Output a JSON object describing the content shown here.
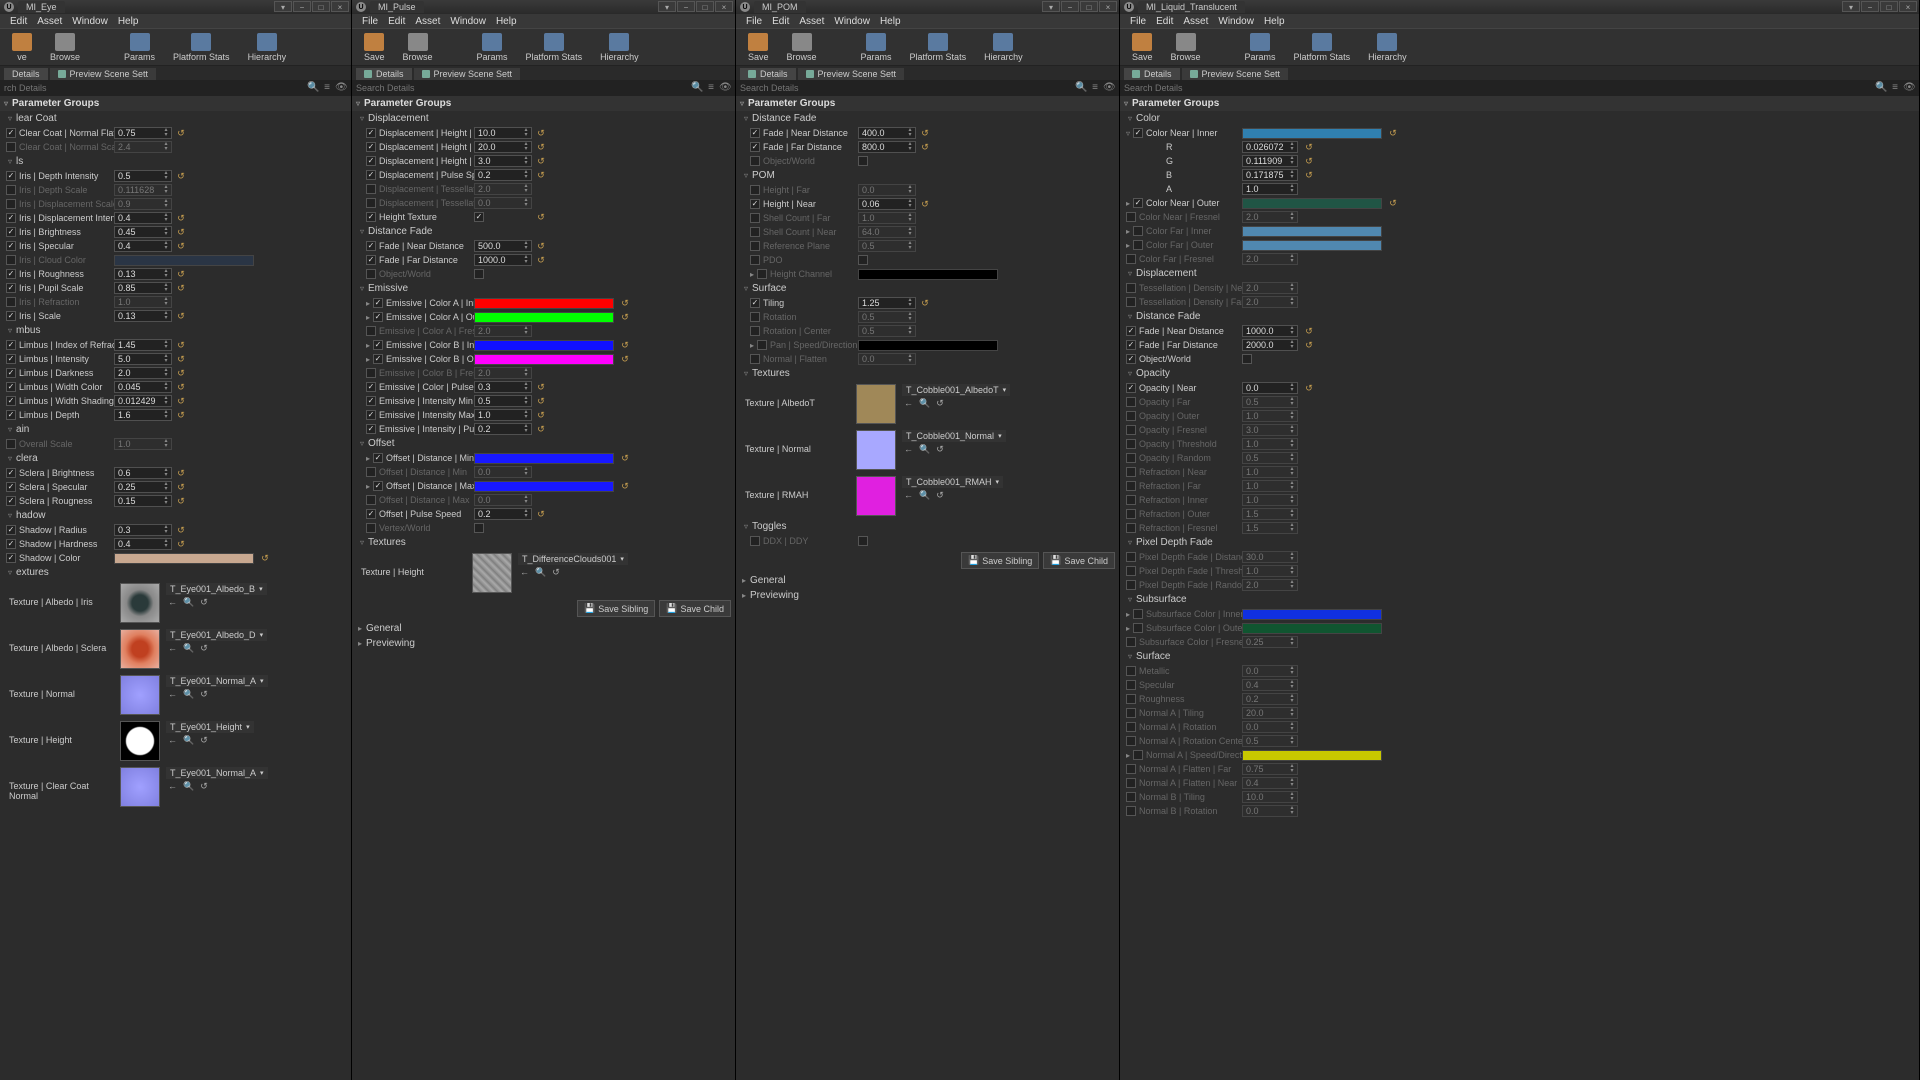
{
  "windows": [
    {
      "title": "MI_Eye"
    },
    {
      "title": "MI_Pulse"
    },
    {
      "title": "MI_POM"
    },
    {
      "title": "MI_Liquid_Translucent"
    }
  ],
  "menu": [
    "File",
    "Edit",
    "Asset",
    "Window",
    "Help"
  ],
  "menu0": [
    "Edit",
    "Asset",
    "Window",
    "Help"
  ],
  "toolbar": {
    "save": "Save",
    "browse": "Browse",
    "params": "Params",
    "platform": "Platform Stats",
    "hierarchy": "Hierarchy"
  },
  "toolbar0": {
    "ve": "ve",
    "browse": "Browse",
    "params": "Params",
    "platform": "Platform Stats",
    "hierarchy": "Hierarchy"
  },
  "tabs": {
    "details": "Details",
    "preview": "Preview Scene Sett"
  },
  "search_ph": "Search Details",
  "search_ph0": "rch Details",
  "hdr": {
    "pg": "Parameter Groups",
    "general": "General",
    "previewing": "Previewing"
  },
  "btn": {
    "saveSib": "Save Sibling",
    "saveChild": "Save Child"
  },
  "eye": {
    "g0": "lear Coat",
    "g1": "ls",
    "g2": "mbus",
    "g3": "ain",
    "g4": "clera",
    "g5": "hadow",
    "g6": "extures",
    "ccnf": "Clear Coat | Normal Flatten",
    "ccnf_v": "0.75",
    "ccns": "Clear Coat | Normal Scale",
    "ccns_v": "2.4",
    "idi": "Iris | Depth Intensity",
    "idi_v": "0.5",
    "ids": "Iris | Depth Scale",
    "ids_v": "0.111628",
    "idis": "Iris | Displacement Scale",
    "idis_v": "0.9",
    "idin": "Iris | Displacement Intensity",
    "idin_v": "0.4",
    "ib": "Iris | Brightness",
    "ib_v": "0.45",
    "isp": "Iris | Specular",
    "isp_v": "0.4",
    "icc": "Iris | Cloud Color",
    "ir": "Iris | Roughness",
    "ir_v": "0.13",
    "ips": "Iris | Pupil Scale",
    "ips_v": "0.85",
    "iref": "Iris | Refraction",
    "iref_v": "1.0",
    "isc": "Iris | Scale",
    "isc_v": "0.13",
    "lir": "Limbus | Index of Refraction",
    "lir_v": "1.45",
    "li": "Limbus | Intensity",
    "li_v": "5.0",
    "ld": "Limbus | Darkness",
    "ld_v": "2.0",
    "lwc": "Limbus | Width Color",
    "lwc_v": "0.045",
    "lws": "Limbus | Width Shading",
    "lws_v": "0.012429",
    "ldp": "Limbus | Depth",
    "ldp_v": "1.6",
    "os": "Overall Scale",
    "os_v": "1.0",
    "sb": "Sclera | Brightness",
    "sb_v": "0.6",
    "ss": "Sclera | Specular",
    "ss_v": "0.25",
    "sr": "Sclera | Rougness",
    "sr_v": "0.15",
    "shr": "Shadow | Radius",
    "shr_v": "0.3",
    "shh": "Shadow | Hardness",
    "shh_v": "0.4",
    "shc": "Shadow | Color",
    "tai": "Texture | Albedo | Iris",
    "tai_n": "T_Eye001_Albedo_B",
    "tas": "Texture | Albedo | Sclera",
    "tas_n": "T_Eye001_Albedo_D",
    "tn": "Texture | Normal",
    "tn_n": "T_Eye001_Normal_A",
    "th": "Texture | Height",
    "th_n": "T_Eye001_Height",
    "tcc": "Texture | Clear Coat Normal",
    "tcc_n": "T_Eye001_Normal_A"
  },
  "pulse": {
    "g0": "Displacement",
    "g1": "Distance Fade",
    "g2": "Emissive",
    "g3": "Offset",
    "g4": "Textures",
    "dhmin": "Displacement | Height | Min",
    "dhmin_v": "10.0",
    "dhmax": "Displacement | Height | Max",
    "dhmax_v": "20.0",
    "dht": "Displacement | Height | Tiling",
    "dht_v": "3.0",
    "dps": "Displacement | Pulse Speed",
    "dps_v": "0.2",
    "dtd": "Displacement | Tessellation Dens",
    "dtd_v": "2.0",
    "dtd2": "Displacement | Tessellation Dens",
    "dtd2_v": "0.0",
    "ht": "Height Texture",
    "fnd": "Fade | Near Distance",
    "fnd_v": "500.0",
    "ffd": "Fade | Far Distance",
    "ffd_v": "1000.0",
    "ow": "Object/World",
    "ecai": "Emissive | Color A | Inner",
    "ecao": "Emissive | Color A | Outer",
    "ecaf": "Emissive | Color A | Fresnel",
    "ecaf_v": "2.0",
    "ecbi": "Emissive | Color B | Inner",
    "ecbo": "Emissive | Color B | Outer",
    "ecbf": "Emissive | Color B | Fresnel",
    "ecbf_v": "2.0",
    "ecps": "Emissive | Color | Pulse Speed",
    "ecps_v": "0.3",
    "eimin": "Emissive | Intensity Min",
    "eimin_v": "0.5",
    "eimax": "Emissive | Intensity Max",
    "eimax_v": "1.0",
    "eips": "Emissive | Intensity | Pulse Speed",
    "eips_v": "0.2",
    "odmin": "Offset | Distance | Min",
    "odmin2": "Offset | Distance | Min",
    "odmin2_v": "0.0",
    "odmax": "Offset | Distance | Max",
    "odmax2": "Offset | Distance | Max",
    "odmax2_v": "0.0",
    "ops": "Offset | Pulse Speed",
    "ops_v": "0.2",
    "vw": "Vertex/World",
    "th": "Texture | Height",
    "th_n": "T_DifferenceClouds001"
  },
  "pom": {
    "g0": "Distance Fade",
    "g1": "POM",
    "g2": "Surface",
    "g3": "Textures",
    "g4": "Toggles",
    "fnd": "Fade | Near Distance",
    "fnd_v": "400.0",
    "ffd": "Fade | Far Distance",
    "ffd_v": "800.0",
    "ow": "Object/World",
    "hf": "Height | Far",
    "hf_v": "0.0",
    "hn": "Height | Near",
    "hn_v": "0.06",
    "scf": "Shell Count | Far",
    "scf_v": "1.0",
    "scn": "Shell Count | Near",
    "scn_v": "64.0",
    "rp": "Reference Plane",
    "rp_v": "0.5",
    "pdo": "PDO",
    "hc": "Height Channel",
    "til": "Tiling",
    "til_v": "1.25",
    "rot": "Rotation",
    "rot_v": "0.5",
    "rotc": "Rotation | Center",
    "rotc_v": "0.5",
    "psd": "Pan | Speed/Direction",
    "nf": "Normal | Flatten",
    "nf_v": "0.0",
    "ta": "Texture | AlbedoT",
    "ta_n": "T_Cobble001_AlbedoT",
    "tn": "Texture | Normal",
    "tn_n": "T_Cobble001_Normal",
    "tr": "Texture | RMAH",
    "tr_n": "T_Cobble001_RMAH",
    "ddx": "DDX | DDY"
  },
  "liq": {
    "g0": "Color",
    "g1": "Displacement",
    "g2": "Distance Fade",
    "g3": "Opacity",
    "g4": "Pixel Depth Fade",
    "g5": "Subsurface",
    "g6": "Surface",
    "cni": "Color Near | Inner",
    "r": "R",
    "r_v": "0.026072",
    "g": "G",
    "g_v": "0.111909",
    "b": "B",
    "b_v": "0.171875",
    "a": "A",
    "a_v": "1.0",
    "cno": "Color Near | Outer",
    "cnf": "Color Near | Fresnel",
    "cnf_v": "2.0",
    "cfi": "Color Far | Inner",
    "cfo": "Color Far | Outer",
    "cff": "Color Far | Fresnel",
    "cff_v": "2.0",
    "tdn": "Tessellation | Density | Near",
    "tdn_v": "2.0",
    "tdf": "Tessellation | Density | Far",
    "tdf_v": "2.0",
    "fnd": "Fade | Near Distance",
    "fnd_v": "1000.0",
    "ffd": "Fade | Far Distance",
    "ffd_v": "2000.0",
    "ow": "Object/World",
    "on": "Opacity | Near",
    "on_v": "0.0",
    "of": "Opacity | Far",
    "of_v": "0.5",
    "oo": "Opacity | Outer",
    "oo_v": "1.0",
    "ofr": "Opacity | Fresnel",
    "ofr_v": "3.0",
    "ot": "Opacity | Threshold",
    "ot_v": "1.0",
    "or": "Opacity | Random",
    "or_v": "0.5",
    "rn": "Refraction | Near",
    "rn_v": "1.0",
    "rf": "Refraction | Far",
    "rf_v": "1.0",
    "ri": "Refraction | Inner",
    "ri_v": "1.0",
    "ro": "Refraction | Outer",
    "ro_v": "1.5",
    "rfr": "Refraction | Fresnel",
    "rfr_v": "1.5",
    "pdfd": "Pixel Depth Fade | Distance",
    "pdfd_v": "30.0",
    "pdft": "Pixel Depth Fade | Threshold",
    "pdft_v": "1.0",
    "pdfr": "Pixel Depth Fade | Random",
    "pdfr_v": "2.0",
    "sci": "Subsurface Color | Inner",
    "sco": "Subsurface Color | Outer",
    "scf": "Subsurface Color | Fresnel",
    "scf_v": "0.25",
    "met": "Metallic",
    "met_v": "0.0",
    "spec": "Specular",
    "spec_v": "0.4",
    "rough": "Roughness",
    "rough_v": "0.2",
    "nat": "Normal A | Tiling",
    "nat_v": "20.0",
    "nar": "Normal A | Rotation",
    "nar_v": "0.0",
    "narc": "Normal A | Rotation Center",
    "narc_v": "0.5",
    "nasd": "Normal A | Speed/Direction",
    "naff": "Normal A | Flatten | Far",
    "naff_v": "0.75",
    "nafn": "Normal A | Flatten | Near",
    "nafn_v": "0.4",
    "nbt": "Normal B | Tiling",
    "nbt_v": "10.0",
    "nbr": "Normal B | Rotation",
    "nbr_v": "0.0"
  }
}
